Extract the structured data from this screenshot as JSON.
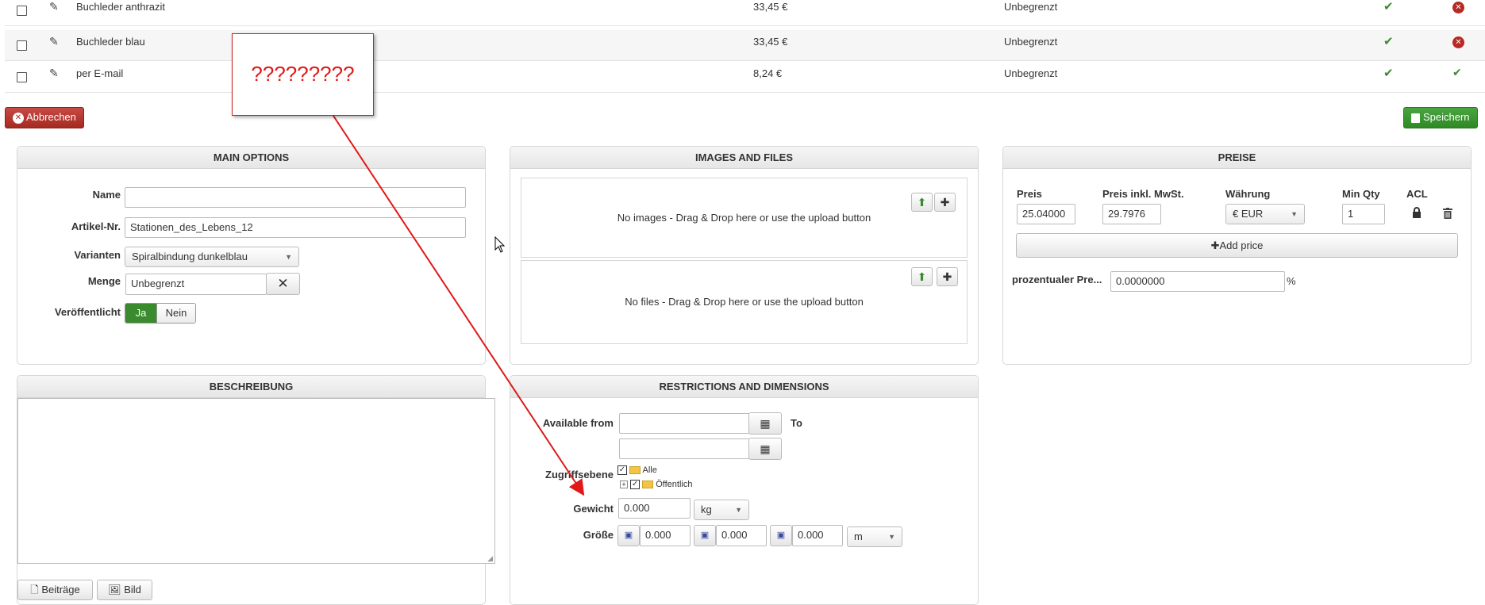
{
  "table": {
    "rows": [
      {
        "name": "Buchleder anthrazit",
        "price": "33,45 €",
        "stock": "Unbegrenzt"
      },
      {
        "name": "Buchleder blau",
        "price": "33,45 €",
        "stock": "Unbegrenzt"
      },
      {
        "name": "per E-mail",
        "price": "8,24 €",
        "stock": "Unbegrenzt"
      }
    ]
  },
  "toolbar": {
    "cancel_label": "Abbrechen",
    "save_label": "Speichern"
  },
  "annotation": {
    "text": "?????????"
  },
  "main_options": {
    "title": "MAIN OPTIONS",
    "name_label": "Name",
    "name_value": "",
    "sku_label": "Artikel-Nr.",
    "sku_value": "Stationen_des_Lebens_12",
    "variants_label": "Varianten",
    "variants_value": "Spiralbindung dunkelblau",
    "quantity_label": "Menge",
    "quantity_value": "Unbegrenzt",
    "published_label": "Veröffentlicht",
    "published_yes": "Ja",
    "published_no": "Nein"
  },
  "images_files": {
    "title": "IMAGES AND FILES",
    "images_text": "No images - Drag & Drop here or use the upload button",
    "files_text": "No files - Drag & Drop here or use the upload button"
  },
  "prices": {
    "title": "PREISE",
    "col_price": "Preis",
    "col_price_gross": "Preis inkl. MwSt.",
    "col_currency": "Währung",
    "col_min_qty": "Min Qty",
    "col_acl": "ACL",
    "price_value": "25.04000",
    "price_gross_value": "29.7976",
    "currency_value": "€ EUR",
    "min_qty_value": "1",
    "add_price_label": "Add price",
    "percent_label": "prozentualer Pre...",
    "percent_value": "0.0000000",
    "percent_unit": "%"
  },
  "description": {
    "title": "BESCHREIBUNG",
    "btn_articles": "Beiträge",
    "btn_image": "Bild"
  },
  "restrictions": {
    "title": "RESTRICTIONS AND DIMENSIONS",
    "available_from_label": "Available from",
    "to_label": "To",
    "access_label": "Zugriffsebene",
    "access_all": "Alle",
    "access_public": "Öffentlich",
    "weight_label": "Gewicht",
    "weight_value": "0.000",
    "weight_unit": "kg",
    "size_label": "Größe",
    "size_l": "0.000",
    "size_w": "0.000",
    "size_h": "0.000",
    "size_unit": "m"
  },
  "colors": {
    "danger": "#b52a24",
    "success": "#3a8a2e",
    "annotation": "#e01818"
  }
}
